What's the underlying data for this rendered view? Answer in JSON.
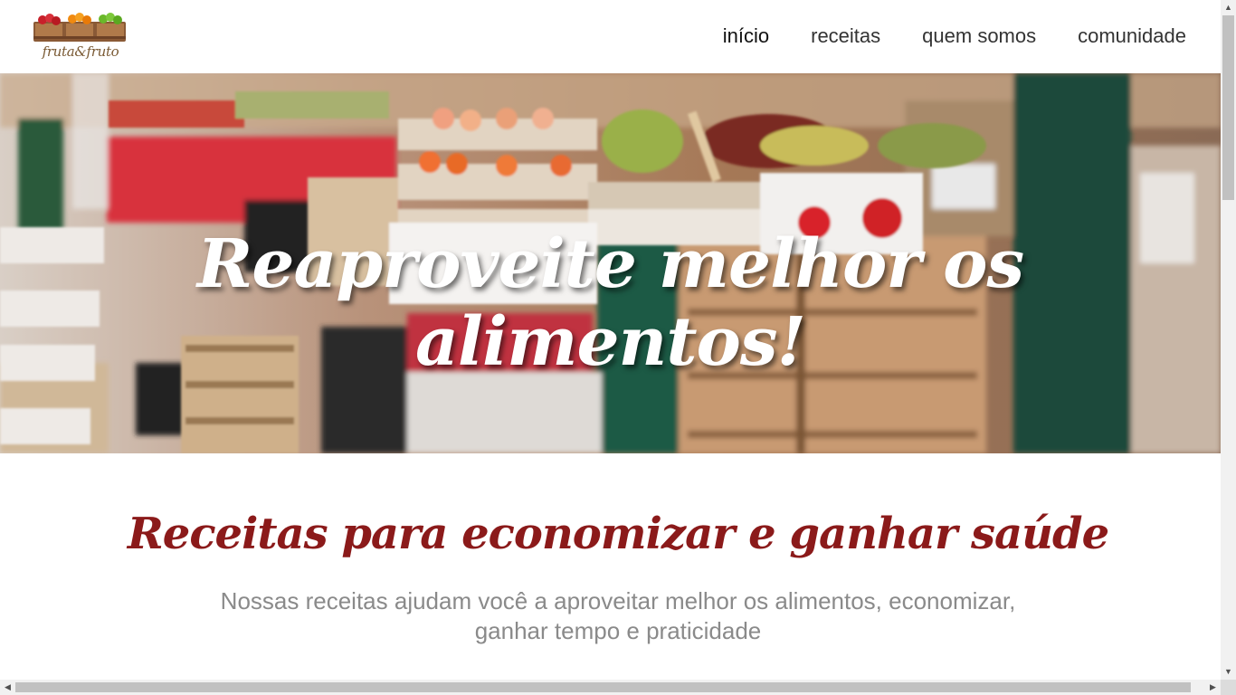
{
  "brand": {
    "logo_text": "fruta&fruto"
  },
  "nav": [
    {
      "label": "início",
      "active": true
    },
    {
      "label": "receitas",
      "active": false
    },
    {
      "label": "quem somos",
      "active": false
    },
    {
      "label": "comunidade",
      "active": false
    }
  ],
  "hero": {
    "title": "Reaproveite melhor os alimentos!"
  },
  "section": {
    "title": "Receitas para economizar e ganhar saúde",
    "subtitle": "Nossas receitas ajudam você a aproveitar melhor os alimentos, economizar, ganhar tempo e praticidade"
  },
  "scroll": {
    "up": "▲",
    "down": "▼",
    "left": "◀",
    "right": "▶"
  },
  "colors": {
    "accent": "#8b1a1a",
    "nav_text": "#333333",
    "subtitle": "#8a8a8a"
  }
}
